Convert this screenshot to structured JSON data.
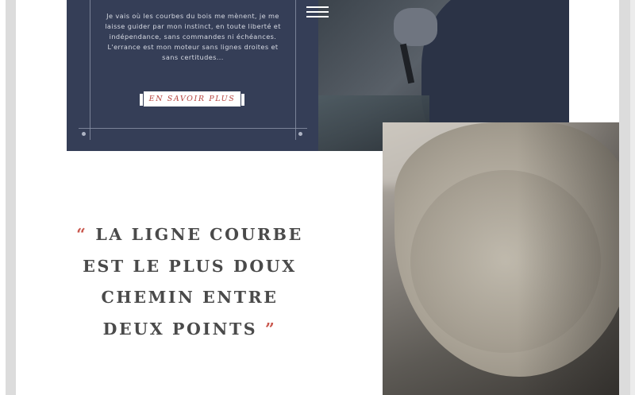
{
  "intro": {
    "text": "Je vais où les courbes du bois me mènent, je me laisse guider par mon instinct, en toute liberté et indépendance, sans commandes ni échéances. L'errance est mon moteur sans lignes droites et sans certitudes...",
    "cta_label": "EN SAVOIR PLUS"
  },
  "nav": {
    "menu_icon": "hamburger-menu-icon"
  },
  "quote": {
    "open_mark": "“",
    "line1": "LA LIGNE COURBE",
    "line2": "EST LE PLUS DOUX",
    "line3": "CHEMIN ENTRE",
    "line4": "DEUX POINTS",
    "close_mark": "”"
  },
  "colors": {
    "panel": "#353e57",
    "accent": "#c9574d",
    "quote_text": "#4a4a4a"
  }
}
